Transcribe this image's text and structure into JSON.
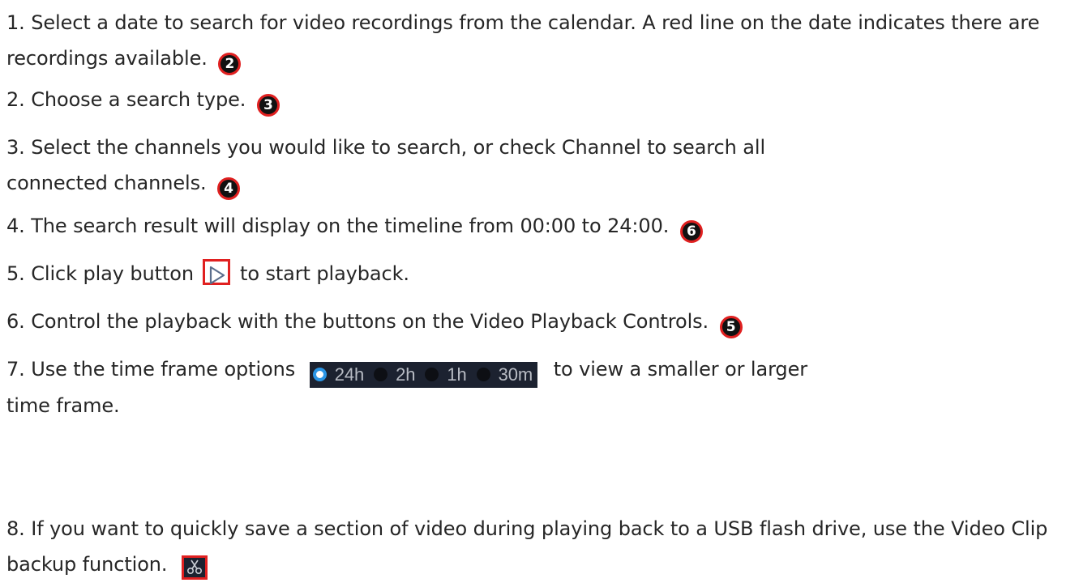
{
  "steps": [
    {
      "text": "1. Select a date to search for video recordings from the calendar.  A red line on the date indicates there are recordings available.",
      "badge": "2"
    },
    {
      "text": "2. Choose a search type.",
      "badge": "3"
    },
    {
      "text": "3. Select the channels you would like to search, or check Channel to search all connected channels.",
      "badge": "4"
    },
    {
      "text": "4. The search result will display on the timeline from 00:00 to 24:00.",
      "badge": "6"
    },
    {
      "text_before": "5. Click play button",
      "text_after": "to start playback."
    },
    {
      "text": "6. Control the playback with the buttons on the Video Playback Controls.",
      "badge": "5"
    },
    {
      "text_before": "7. Use the time frame options",
      "text_after": "to view a smaller or larger time frame."
    },
    {
      "text_before": "8. If you want to quickly save a section of video during playing back to a USB flash drive, use the Video Clip backup function."
    }
  ],
  "time_frame": {
    "options": [
      "24h",
      "2h",
      "1h",
      "30m"
    ],
    "selected": "24h"
  },
  "icons": {
    "play": "play-icon",
    "clip": "scissors-icon"
  },
  "colors": {
    "highlight_border": "#e02020",
    "control_bg": "#1c2230",
    "radio_selected": "#2b96e6"
  }
}
